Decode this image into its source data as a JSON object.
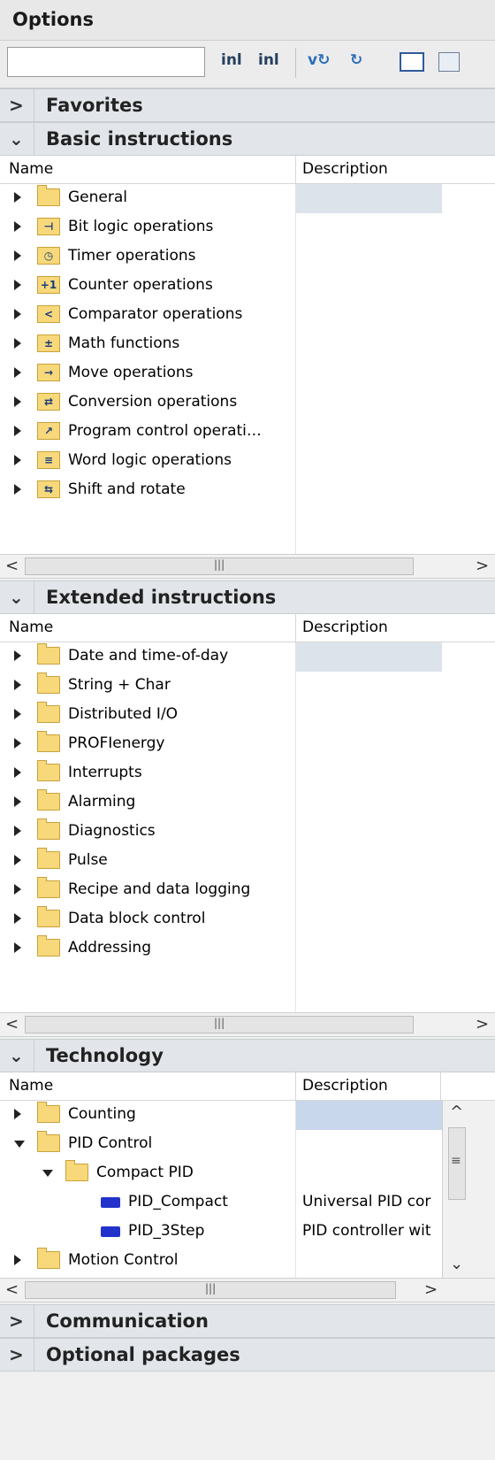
{
  "panel": {
    "title": "Options"
  },
  "toolbar": {
    "search_value": ""
  },
  "favorites": {
    "title": "Favorites"
  },
  "basic": {
    "title": "Basic instructions",
    "col_name": "Name",
    "col_desc": "Description",
    "items": [
      {
        "label": "General",
        "icon": "folder-icon"
      },
      {
        "label": "Bit logic operations",
        "icon": "bit-logic-icon"
      },
      {
        "label": "Timer operations",
        "icon": "timer-icon"
      },
      {
        "label": "Counter operations",
        "icon": "counter-icon"
      },
      {
        "label": "Comparator operations",
        "icon": "comparator-icon"
      },
      {
        "label": "Math functions",
        "icon": "math-icon"
      },
      {
        "label": "Move operations",
        "icon": "move-icon"
      },
      {
        "label": "Conversion operations",
        "icon": "conversion-icon"
      },
      {
        "label": "Program control operati…",
        "icon": "program-control-icon"
      },
      {
        "label": "Word logic operations",
        "icon": "word-logic-icon"
      },
      {
        "label": "Shift and rotate",
        "icon": "shift-rotate-icon"
      }
    ]
  },
  "extended": {
    "title": "Extended instructions",
    "col_name": "Name",
    "col_desc": "Description",
    "items": [
      {
        "label": "Date and time-of-day"
      },
      {
        "label": "String + Char"
      },
      {
        "label": "Distributed I/O"
      },
      {
        "label": "PROFIenergy"
      },
      {
        "label": "Interrupts"
      },
      {
        "label": "Alarming"
      },
      {
        "label": "Diagnostics"
      },
      {
        "label": "Pulse"
      },
      {
        "label": "Recipe and data logging"
      },
      {
        "label": "Data block control"
      },
      {
        "label": "Addressing"
      }
    ]
  },
  "technology": {
    "title": "Technology",
    "col_name": "Name",
    "col_desc": "Description",
    "items": [
      {
        "label": "Counting",
        "desc": "",
        "level": 0,
        "kind": "folder",
        "expanded": false
      },
      {
        "label": "PID Control",
        "desc": "",
        "level": 0,
        "kind": "folder",
        "expanded": true
      },
      {
        "label": "Compact PID",
        "desc": "",
        "level": 1,
        "kind": "folder",
        "expanded": true
      },
      {
        "label": "PID_Compact",
        "desc": "Universal PID cor",
        "level": 2,
        "kind": "block"
      },
      {
        "label": "PID_3Step",
        "desc": "PID controller wit",
        "level": 2,
        "kind": "block"
      },
      {
        "label": "Motion Control",
        "desc": "",
        "level": 0,
        "kind": "folder",
        "expanded": false
      }
    ]
  },
  "communication": {
    "title": "Communication"
  },
  "optional": {
    "title": "Optional packages"
  },
  "colors": {
    "folder": "#f7d87a",
    "highlight": "#c9d7ec",
    "header": "#e2e6ea",
    "block": "#2233cc"
  }
}
